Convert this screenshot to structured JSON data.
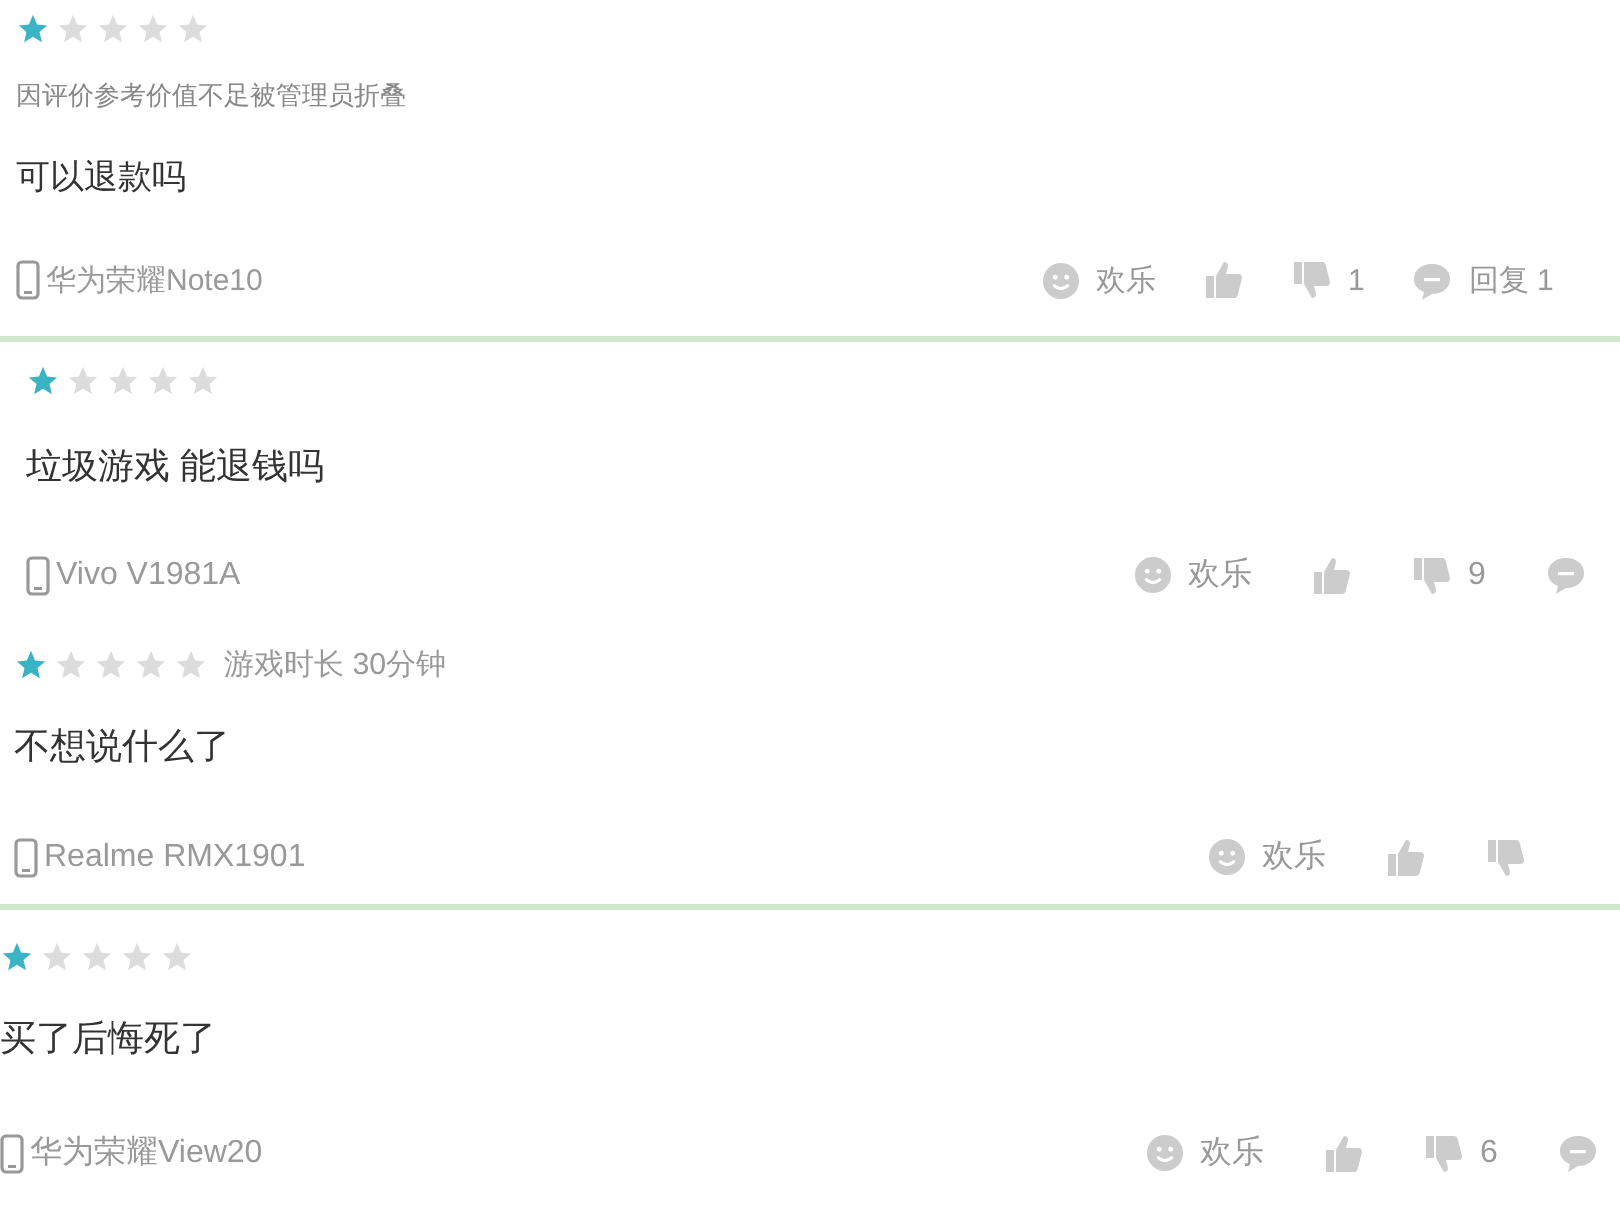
{
  "reviews": [
    {
      "stars": 1,
      "folded_note": "因评价参考价值不足被管理员折叠",
      "text": "可以退款吗",
      "device": "华为荣耀Note10",
      "actions": [
        {
          "kind": "emoji",
          "label": "欢乐"
        },
        {
          "kind": "like"
        },
        {
          "kind": "dislike",
          "count": "1"
        },
        {
          "kind": "reply",
          "label": "回复 1"
        }
      ]
    },
    {
      "stars": 1,
      "text": "垃圾游戏 能退钱吗",
      "device": "Vivo V1981A",
      "actions": [
        {
          "kind": "emoji",
          "label": "欢乐"
        },
        {
          "kind": "like"
        },
        {
          "kind": "dislike",
          "count": "9"
        },
        {
          "kind": "reply"
        }
      ]
    },
    {
      "stars": 1,
      "playtime": "游戏时长 30分钟",
      "text": "不想说什么了",
      "device": "Realme RMX1901",
      "actions": [
        {
          "kind": "emoji",
          "label": "欢乐"
        },
        {
          "kind": "like"
        },
        {
          "kind": "dislike"
        }
      ]
    },
    {
      "stars": 1,
      "text": "买了后悔死了",
      "device": "华为荣耀View20",
      "actions": [
        {
          "kind": "emoji",
          "label": "欢乐"
        },
        {
          "kind": "like"
        },
        {
          "kind": "dislike",
          "count": "6"
        },
        {
          "kind": "reply"
        }
      ]
    }
  ]
}
